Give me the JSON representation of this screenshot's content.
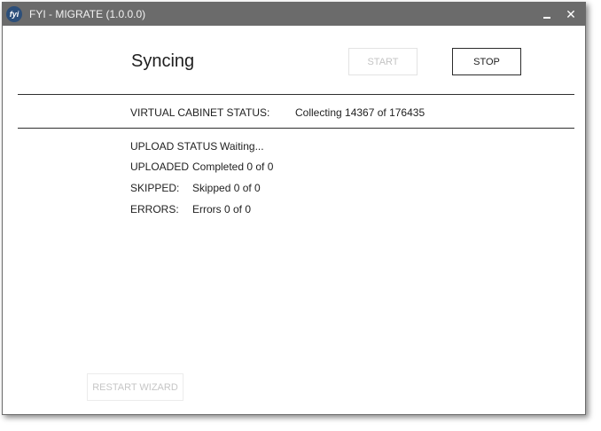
{
  "window": {
    "title": "FYI - MIGRATE (1.0.0.0)",
    "logo_text": "fyi",
    "close_glyph": "✕"
  },
  "main": {
    "heading": "Syncing",
    "start_label": "START",
    "stop_label": "STOP",
    "restart_label": "RESTART WIZARD"
  },
  "status": {
    "cabinet_label": "VIRTUAL CABINET STATUS:",
    "cabinet_value": "Collecting 14367 of 176435",
    "upload_label": "UPLOAD STATUS",
    "upload_value": "Waiting...",
    "uploaded_label": "UPLOADED",
    "uploaded_value": "Completed 0 of 0",
    "skipped_label": "SKIPPED:",
    "skipped_value": "Skipped 0 of 0",
    "errors_label": "ERRORS:",
    "errors_value": "Errors 0 of 0"
  },
  "colors": {
    "titlebar": "#6b6b6b",
    "logo": "#2c4f7a",
    "disabled_text": "#c4c4c4"
  },
  "icons": {
    "logo": "app-logo-icon",
    "minimize": "minimize-icon",
    "close": "close-icon"
  }
}
